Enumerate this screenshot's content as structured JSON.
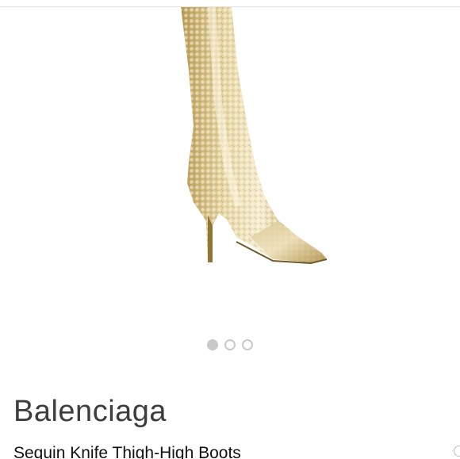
{
  "product": {
    "brand": "Balenciaga",
    "name": "Sequin Knife Thigh-High Boots",
    "image_icon": "sequin-boot-photo"
  },
  "carousel": {
    "total_slides": 3,
    "active_slide": 1
  },
  "colors": {
    "gold": "#c8a95c",
    "gold_light": "#ece0b8",
    "dot": "#c9c9c9",
    "brand_text": "#3d3d3d"
  }
}
